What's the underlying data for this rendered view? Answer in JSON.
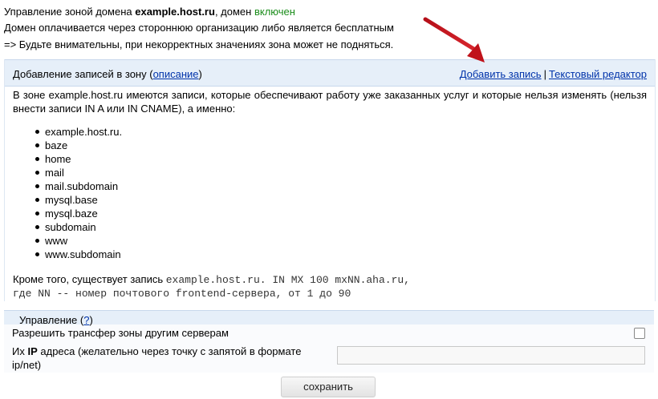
{
  "header": {
    "zone_prefix": "Управление зоной домена",
    "domain": "example.host.ru",
    "status_prefix": ", домен",
    "status": "включен",
    "payment_note": "Домен оплачивается через стороннюю организацию либо является бесплатным",
    "warning": "=> Будьте внимательны, при некорректных значениях зона может не подняться."
  },
  "panel": {
    "title": "Добавление записей в зону",
    "description_link": "описание",
    "add_record_link": "Добавить запись",
    "separator": "|",
    "text_editor_link": "Текстовый редактор",
    "intro": "В зоне example.host.ru имеются записи, которые обеспечивают работу уже заказанных услуг и которые нельзя изменять (нельзя внести записи IN A или IN CNAME), а именно:",
    "hosts": [
      "example.host.ru.",
      "baze",
      "home",
      "mail",
      "mail.subdomain",
      "mysql.base",
      "mysql.baze",
      "subdomain",
      "www",
      "www.subdomain"
    ],
    "extra_prefix": "Кроме того, существует запись",
    "extra_record": "example.host.ru. IN MX 100 mxNN.aha.ru,",
    "extra_note": "где NN -- номер почтового frontend-сервера, от 1 до 90"
  },
  "management": {
    "title": "Управление",
    "help_link": "?",
    "zone_transfer_label": "Разрешить трансфер зоны другим серверам",
    "zone_transfer_checked": false,
    "ip_label_prefix": "Их",
    "ip_label_bold": "IP",
    "ip_label_rest": "адреса (желательно через точку с запятой в формате",
    "ip_label_line2": "ip/net)",
    "ip_value": ""
  },
  "save_button": "сохранить",
  "colors": {
    "status_enabled": "#1a8c1a",
    "link": "#0033aa",
    "panel_header": "#e6eff9",
    "annotation_arrow": "#c0121a"
  }
}
